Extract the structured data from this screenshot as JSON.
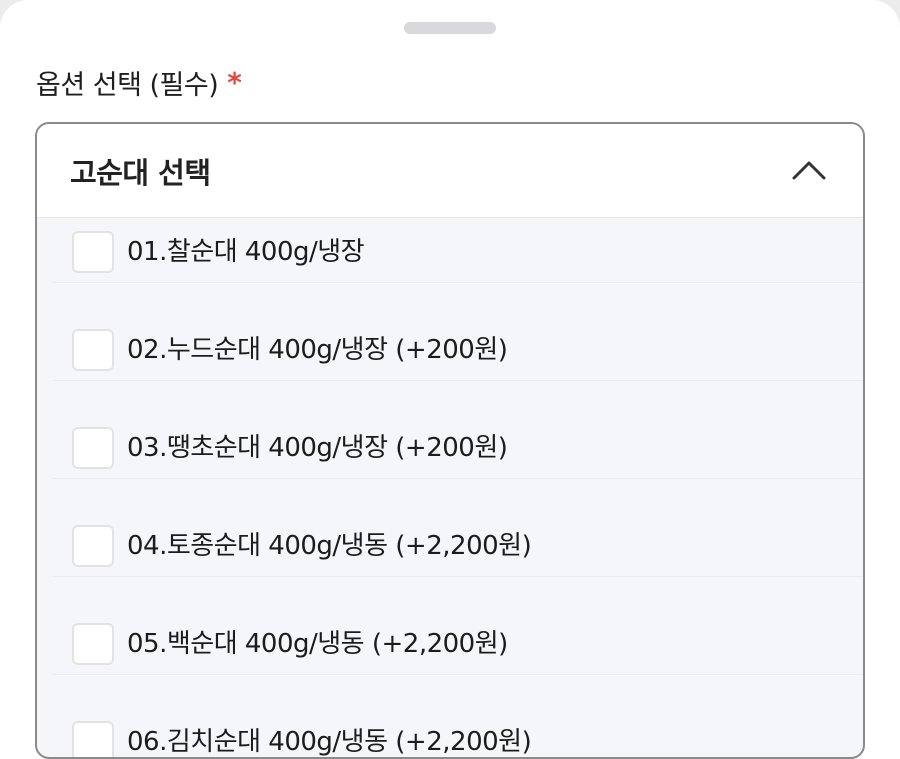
{
  "section": {
    "label": "옵션 선택 (필수)",
    "required_mark": "*"
  },
  "select": {
    "title": "고순대 선택",
    "expanded": true,
    "options": [
      {
        "label": "01.찰순대 400g/냉장",
        "checked": false
      },
      {
        "label": "02.누드순대 400g/냉장 (+200원)",
        "checked": false
      },
      {
        "label": "03.땡초순대 400g/냉장 (+200원)",
        "checked": false
      },
      {
        "label": "04.토종순대 400g/냉동 (+2,200원)",
        "checked": false
      },
      {
        "label": "05.백순대 400g/냉동 (+2,200원)",
        "checked": false
      },
      {
        "label": "06.김치순대 400g/냉동 (+2,200원)",
        "checked": false
      }
    ]
  },
  "colors": {
    "required": "#e5483f",
    "border": "#8a8a8a",
    "list_background": "#f5f6f9"
  },
  "icons": {
    "chevron": "chevron-up-icon"
  }
}
